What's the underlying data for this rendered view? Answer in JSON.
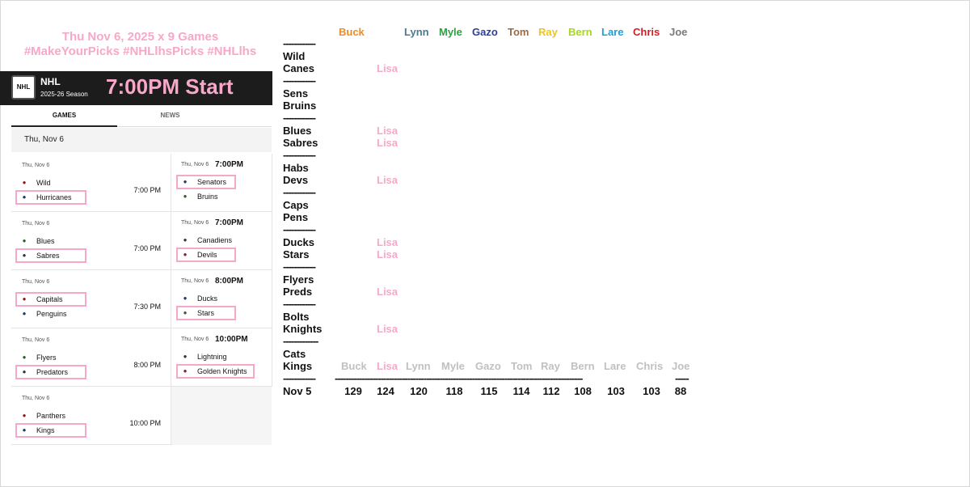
{
  "header": {
    "line1": "Thu Nov 6, 2025    x 9 Games",
    "line2": "#MakeYourPicks #NHLlhsPicks #NHLlhs",
    "league": "NHL",
    "season": "2025-26 Season",
    "start": "7:00PM Start"
  },
  "tabs": {
    "games": "GAMES",
    "news": "NEWS"
  },
  "date_header": "Thu, Nov 6",
  "games": [
    {
      "date": "Thu, Nov 6",
      "time": "7:00 PM",
      "time_strong": "",
      "away": "Wild",
      "home": "Hurricanes",
      "picked": "home",
      "away_icon": "wild-logo-icon",
      "home_icon": "hurricanes-logo-icon"
    },
    {
      "date": "Thu, Nov 6",
      "time": "",
      "time_strong": "7:00PM",
      "away": "Senators",
      "home": "Bruins",
      "picked": "away",
      "away_icon": "senators-logo-icon",
      "home_icon": "bruins-logo-icon"
    },
    {
      "date": "Thu, Nov 6",
      "time": "7:00 PM",
      "time_strong": "",
      "away": "Blues",
      "home": "Sabres",
      "picked": "home",
      "away_icon": "blues-logo-icon",
      "home_icon": "sabres-logo-icon"
    },
    {
      "date": "Thu, Nov 6",
      "time": "",
      "time_strong": "7:00PM",
      "away": "Canadiens",
      "home": "Devils",
      "picked": "home",
      "away_icon": "canadiens-logo-icon",
      "home_icon": "devils-logo-icon"
    },
    {
      "date": "Thu, Nov 6",
      "time": "7:30 PM",
      "time_strong": "",
      "away": "Capitals",
      "home": "Penguins",
      "picked": "away",
      "away_icon": "capitals-logo-icon",
      "home_icon": "penguins-logo-icon"
    },
    {
      "date": "Thu, Nov 6",
      "time": "",
      "time_strong": "8:00PM",
      "away": "Ducks",
      "home": "Stars",
      "picked": "home",
      "away_icon": "ducks-logo-icon",
      "home_icon": "stars-logo-icon"
    },
    {
      "date": "Thu, Nov 6",
      "time": "8:00 PM",
      "time_strong": "",
      "away": "Flyers",
      "home": "Predators",
      "picked": "home",
      "away_icon": "flyers-logo-icon",
      "home_icon": "predators-logo-icon"
    },
    {
      "date": "Thu, Nov 6",
      "time": "",
      "time_strong": "10:00PM",
      "away": "Lightning",
      "home": "Golden Knights",
      "picked": "home",
      "away_icon": "lightning-logo-icon",
      "home_icon": "golden-knights-logo-icon"
    },
    {
      "date": "Thu, Nov 6",
      "time": "10:00 PM",
      "time_strong": "",
      "away": "Panthers",
      "home": "Kings",
      "picked": "home",
      "away_icon": "panthers-logo-icon",
      "home_icon": "kings-logo-icon"
    }
  ],
  "pickers": [
    {
      "name": "Buck",
      "color": "#f08a24"
    },
    {
      "name": "Lynn",
      "color": "#4a7a8c"
    },
    {
      "name": "Myle",
      "color": "#2ea043"
    },
    {
      "name": "Gazo",
      "color": "#2c3e9e"
    },
    {
      "name": "Tom",
      "color": "#9c6b44"
    },
    {
      "name": "Ray",
      "color": "#f0c419"
    },
    {
      "name": "Bern",
      "color": "#a6d81a"
    },
    {
      "name": "Lare",
      "color": "#1ea0dc"
    },
    {
      "name": "Chris",
      "color": "#d0202a"
    },
    {
      "name": "Joe",
      "color": "#7a7a7a"
    }
  ],
  "lisa_color": "#f7a8c8",
  "separator": "------------",
  "separator_long": "-------------",
  "matchups": [
    {
      "a": "Wild",
      "b": "Canes",
      "lisa": "Lisa",
      "lisa_row": "b"
    },
    {
      "a": "Sens",
      "b": "Bruins",
      "lisa": "Lisa",
      "lisa_row": "a"
    },
    {
      "a": "Blues",
      "b": "Sabres",
      "lisa": "Lisa",
      "lisa_row": "b"
    },
    {
      "a": "Habs",
      "b": "Devs",
      "lisa": "Lisa",
      "lisa_row": "b"
    },
    {
      "a": "Caps",
      "b": "Pens",
      "lisa": "Lisa",
      "lisa_row": "a"
    },
    {
      "a": "Ducks",
      "b": "Stars",
      "lisa": "Lisa",
      "lisa_row": "b"
    },
    {
      "a": "Flyers",
      "b": "Preds",
      "lisa": "Lisa",
      "lisa_row": "b"
    },
    {
      "a": "Bolts",
      "b": "Knights",
      "lisa": "Lisa",
      "lisa_row": "b"
    },
    {
      "a": "Cats",
      "b": "Kings",
      "lisa": "",
      "lisa_row": ""
    }
  ],
  "standings": {
    "names": [
      "Buck",
      "Lisa",
      "Lynn",
      "Myle",
      "Gazo",
      "Tom",
      "Ray",
      "Bern",
      "Lare",
      "Chris",
      "Joe"
    ],
    "dash_line": "--------------------------------------------------------------------------------------------",
    "dash_tail": "-----",
    "date": "Nov 5",
    "scores": [
      "129",
      "124",
      "120",
      "118",
      "115",
      "114",
      "112",
      "108",
      "103",
      "103",
      "88"
    ]
  }
}
